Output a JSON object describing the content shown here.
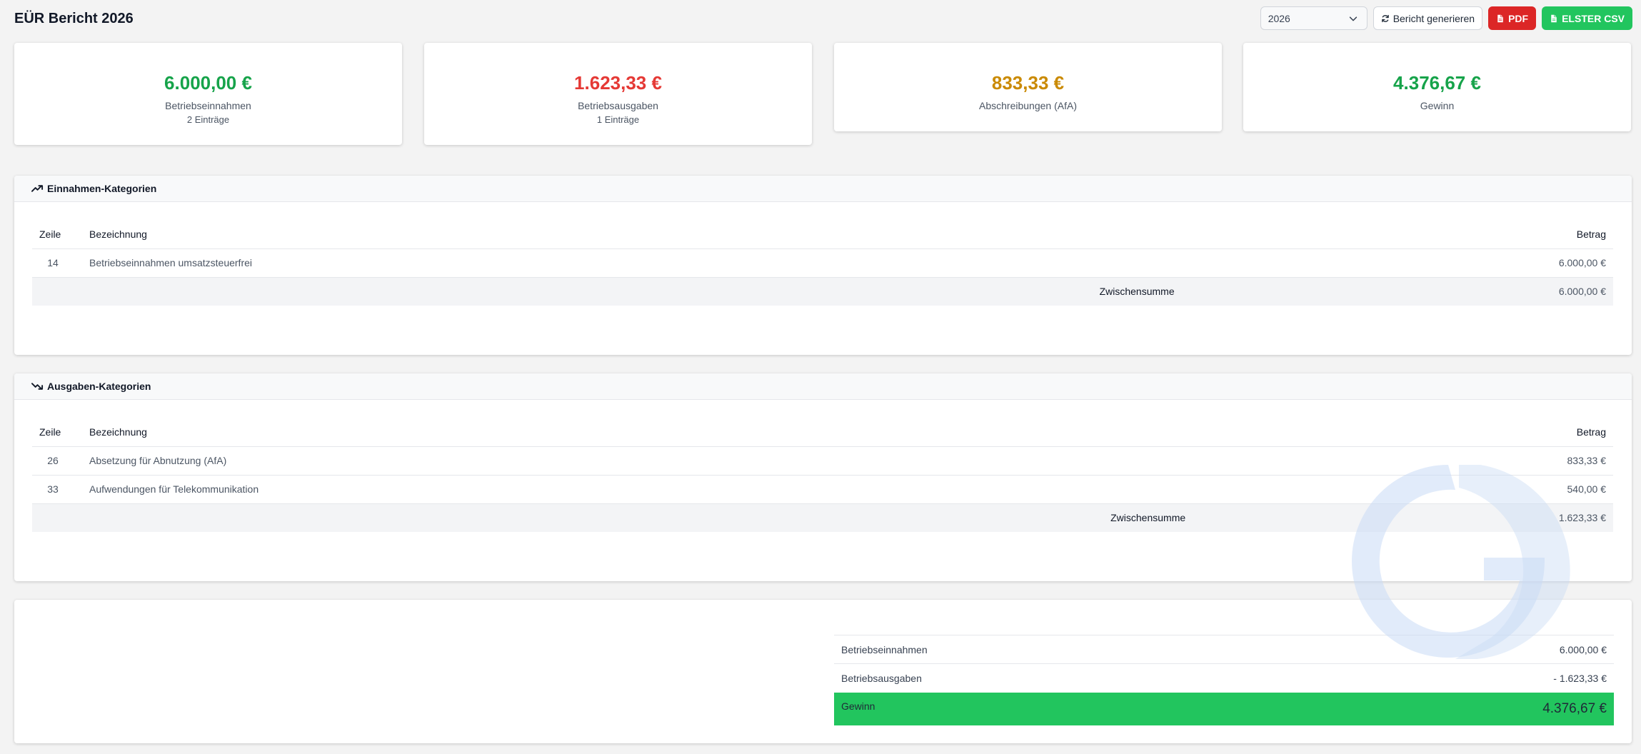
{
  "header": {
    "title": "EÜR Bericht 2026",
    "year_select": {
      "value": "2026"
    },
    "buttons": {
      "generate": "Bericht generieren",
      "pdf": "PDF",
      "elster": "ELSTER CSV"
    }
  },
  "stats": [
    {
      "value": "6.000,00 €",
      "label": "Betriebseinnahmen",
      "sub": "2 Einträge",
      "color": "#16a34a"
    },
    {
      "value": "1.623,33 €",
      "label": "Betriebsausgaben",
      "sub": "1 Einträge",
      "color": "#e53935"
    },
    {
      "value": "833,33 €",
      "label": "Abschreibungen (AfA)",
      "sub": "",
      "color": "#ca8a04"
    },
    {
      "value": "4.376,67 €",
      "label": "Gewinn",
      "sub": "",
      "color": "#16a34a"
    }
  ],
  "income": {
    "title": "Einnahmen-Kategorien",
    "icon": "trending-up-icon",
    "columns": {
      "zeile": "Zeile",
      "bezeichnung": "Bezeichnung",
      "betrag": "Betrag"
    },
    "rows": [
      {
        "zeile": "14",
        "bezeichnung": "Betriebseinnahmen umsatzsteuerfrei",
        "betrag": "6.000,00 €"
      }
    ],
    "subtotal_label": "Zwischensumme",
    "subtotal_value": "6.000,00 €"
  },
  "expenses": {
    "title": "Ausgaben-Kategorien",
    "icon": "trending-down-icon",
    "columns": {
      "zeile": "Zeile",
      "bezeichnung": "Bezeichnung",
      "betrag": "Betrag"
    },
    "rows": [
      {
        "zeile": "26",
        "bezeichnung": "Absetzung für Abnutzung (AfA)",
        "betrag": "833,33 €"
      },
      {
        "zeile": "33",
        "bezeichnung": "Aufwendungen für Telekommunikation",
        "betrag": "540,00 €"
      }
    ],
    "subtotal_label": "Zwischensumme",
    "subtotal_value": "1.623,33 €"
  },
  "summary": {
    "income_label": "Betriebseinnahmen",
    "income_value": "6.000,00 €",
    "expense_label": "Betriebsausgaben",
    "expense_value": "- 1.623,33 €",
    "profit_label": "Gewinn",
    "profit_value": "4.376,67 €",
    "profit_color": "#22c55e"
  }
}
